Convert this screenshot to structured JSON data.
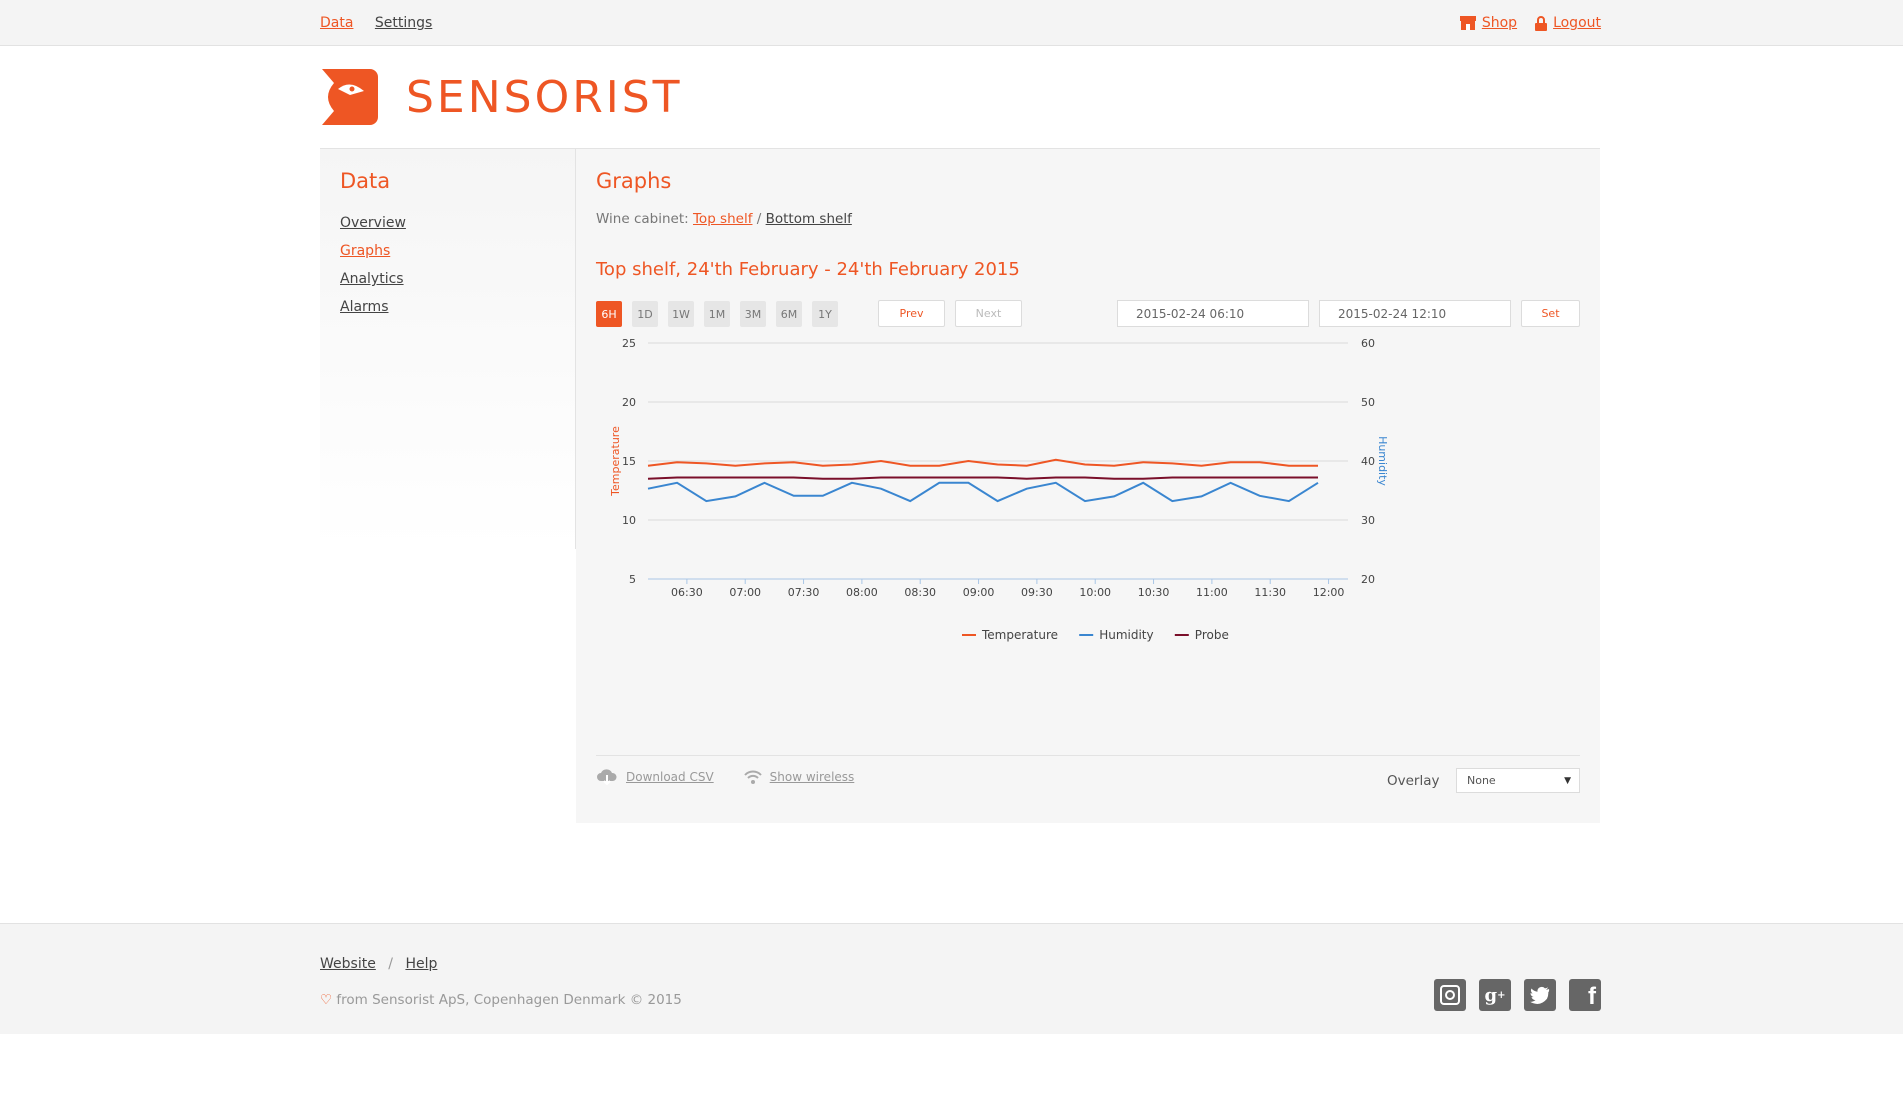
{
  "topnav": {
    "data": "Data",
    "settings": "Settings",
    "shop": "Shop",
    "logout": "Logout"
  },
  "brand": {
    "name": "SENSORIST",
    "color": "#ee5624"
  },
  "sidebar": {
    "title": "Data",
    "items": [
      {
        "label": "Overview"
      },
      {
        "label": "Graphs"
      },
      {
        "label": "Analytics"
      },
      {
        "label": "Alarms"
      }
    ]
  },
  "main": {
    "title": "Graphs",
    "cabinet_prefix": "Wine cabinet:",
    "cabinet_options": [
      "Top shelf",
      "Bottom shelf"
    ],
    "cabinet_separator": " / ",
    "graph_title": "Top shelf, 24'th February - 24'th February 2015",
    "ranges": [
      "6H",
      "1D",
      "1W",
      "1M",
      "3M",
      "6M",
      "1Y"
    ],
    "active_range": "6H",
    "prev": "Prev",
    "next": "Next",
    "from_date": "2015-02-24 06:10",
    "to_date": "2015-02-24 12:10",
    "set": "Set",
    "download_csv": "Download CSV",
    "show_wireless": "Show wireless",
    "overlay_label": "Overlay",
    "overlay_value": "None"
  },
  "chart_data": {
    "type": "line",
    "x": [
      "06:10",
      "06:20",
      "06:30",
      "06:40",
      "06:50",
      "07:00",
      "07:10",
      "07:20",
      "07:30",
      "07:40",
      "07:50",
      "08:00",
      "08:10",
      "08:20",
      "08:30",
      "08:40",
      "08:50",
      "09:00",
      "09:10",
      "09:20",
      "09:30",
      "09:40",
      "09:50",
      "10:00",
      "10:10",
      "10:20",
      "10:30",
      "10:40",
      "10:50",
      "11:00",
      "11:10",
      "11:20",
      "11:30",
      "11:40",
      "11:50",
      "12:00"
    ],
    "xticks": [
      "06:30",
      "07:00",
      "07:30",
      "08:00",
      "08:30",
      "09:00",
      "09:30",
      "10:00",
      "10:30",
      "11:00",
      "11:30",
      "12:00"
    ],
    "series": [
      {
        "name": "Temperature",
        "color": "#ee5624",
        "axis": "left",
        "values": [
          14.6,
          14.9,
          14.8,
          14.6,
          14.8,
          14.9,
          14.6,
          14.7,
          15.0,
          14.6,
          14.6,
          15.0,
          14.7,
          14.6,
          15.1,
          14.7,
          14.6,
          14.9,
          14.8,
          14.6,
          14.9,
          14.9,
          14.6,
          14.6
        ]
      },
      {
        "name": "Humidity",
        "color": "#3a86d0",
        "axis": "right",
        "values": [
          35.3,
          36.3,
          33.2,
          34.0,
          36.3,
          34.1,
          34.1,
          36.3,
          35.3,
          33.2,
          36.3,
          36.3,
          33.2,
          35.3,
          36.3,
          33.2,
          34.0,
          36.3,
          33.2,
          34.0,
          36.3,
          34.1,
          33.2,
          36.3
        ]
      },
      {
        "name": "Probe",
        "color": "#7a0f2a",
        "axis": "left",
        "values": [
          13.5,
          13.6,
          13.6,
          13.6,
          13.6,
          13.6,
          13.5,
          13.5,
          13.6,
          13.6,
          13.6,
          13.6,
          13.6,
          13.5,
          13.6,
          13.6,
          13.5,
          13.5,
          13.6,
          13.6,
          13.6,
          13.6,
          13.6,
          13.6
        ]
      }
    ],
    "ylabel_left": "Temperature",
    "ylabel_right": "Humidity",
    "ylim_left": [
      5,
      25
    ],
    "ylim_right": [
      20,
      60
    ],
    "yticks_left": [
      5,
      10,
      15,
      20,
      25
    ],
    "yticks_right": [
      20,
      30,
      40,
      50,
      60
    ],
    "grid": true,
    "legend": "bottom"
  },
  "footer": {
    "website": "Website",
    "sep": "/",
    "help": "Help",
    "copyright_rest": " from Sensorist ApS, Copenhagen Denmark © 2015"
  },
  "social": [
    {
      "icon": "instagram-icon"
    },
    {
      "icon": "google-plus-icon"
    },
    {
      "icon": "twitter-icon"
    },
    {
      "icon": "facebook-icon"
    }
  ]
}
